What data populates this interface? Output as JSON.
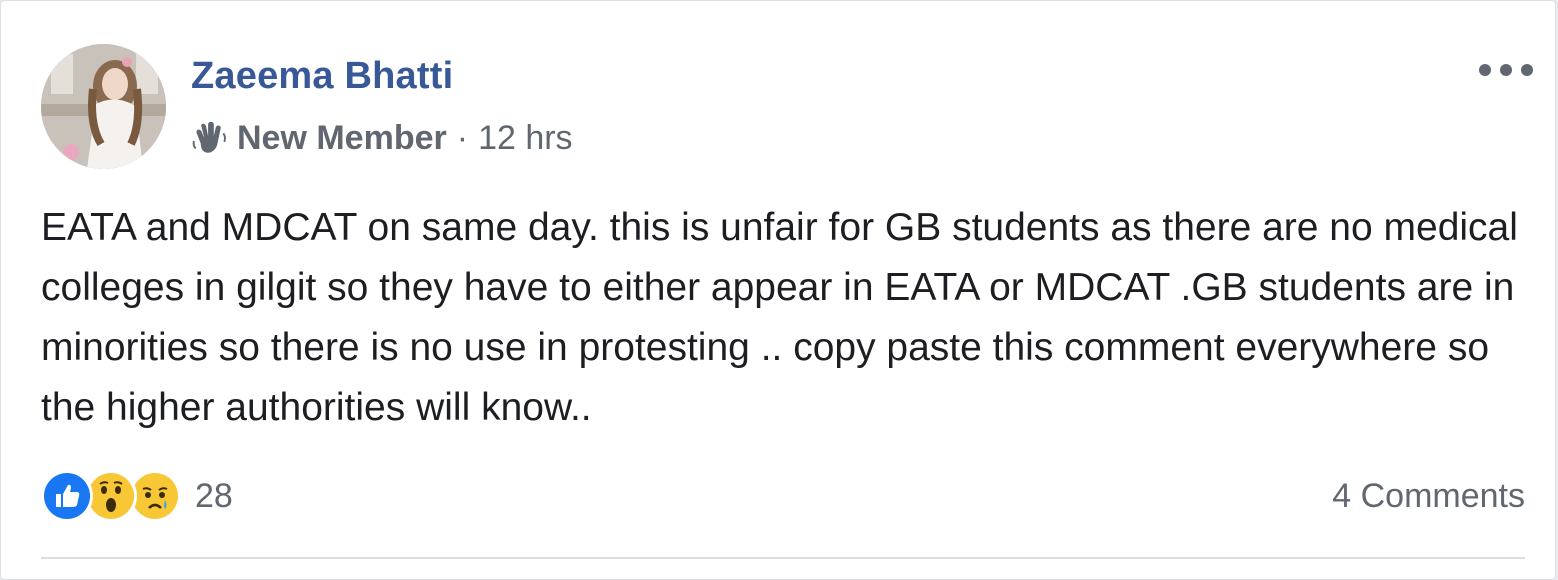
{
  "post": {
    "author": "Zaeema Bhatti",
    "badge_label": "New Member",
    "separator": "·",
    "time": "12 hrs",
    "text": "EATA and MDCAT on same day. this is unfair for GB students as there are no medical colleges in gilgit so they have to either appear in EATA or MDCAT .GB students are in minorities so there is no use in protesting .. copy paste this comment everywhere so the higher authorities will know..",
    "reaction_count": "28",
    "comments_label": "4 Comments",
    "reactions": [
      "like-icon",
      "wow-icon",
      "sad-icon"
    ],
    "badge_icon": "waving-hand-icon",
    "more_icon": "more-options-icon"
  },
  "colors": {
    "author": "#385898",
    "secondary_text": "#606770",
    "body_text": "#1c1e21",
    "like_blue": "#1877f2",
    "emoji_yellow": "#f7c736"
  }
}
